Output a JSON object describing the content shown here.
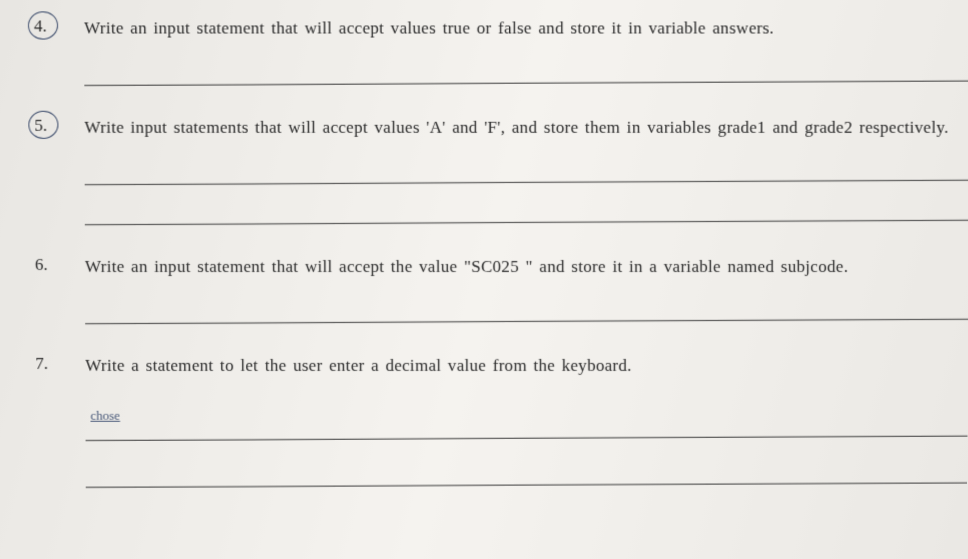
{
  "questions": [
    {
      "number": "4.",
      "circled": true,
      "text": "Write an input statement that will accept values true or false and store it in variable answers.",
      "lines": 1,
      "handwritten": ""
    },
    {
      "number": "5.",
      "circled": true,
      "text": "Write input statements that will accept values 'A' and 'F', and store them in variables grade1 and grade2 respectively.",
      "lines": 2,
      "handwritten": ""
    },
    {
      "number": "6.",
      "circled": false,
      "text": "Write an input statement that will accept the value \"SC025 \" and store it in a variable named subjcode.",
      "lines": 1,
      "handwritten": ""
    },
    {
      "number": "7.",
      "circled": false,
      "text": "Write a statement to let the user enter a decimal value from the keyboard.",
      "lines": 2,
      "handwritten": "chose"
    }
  ]
}
